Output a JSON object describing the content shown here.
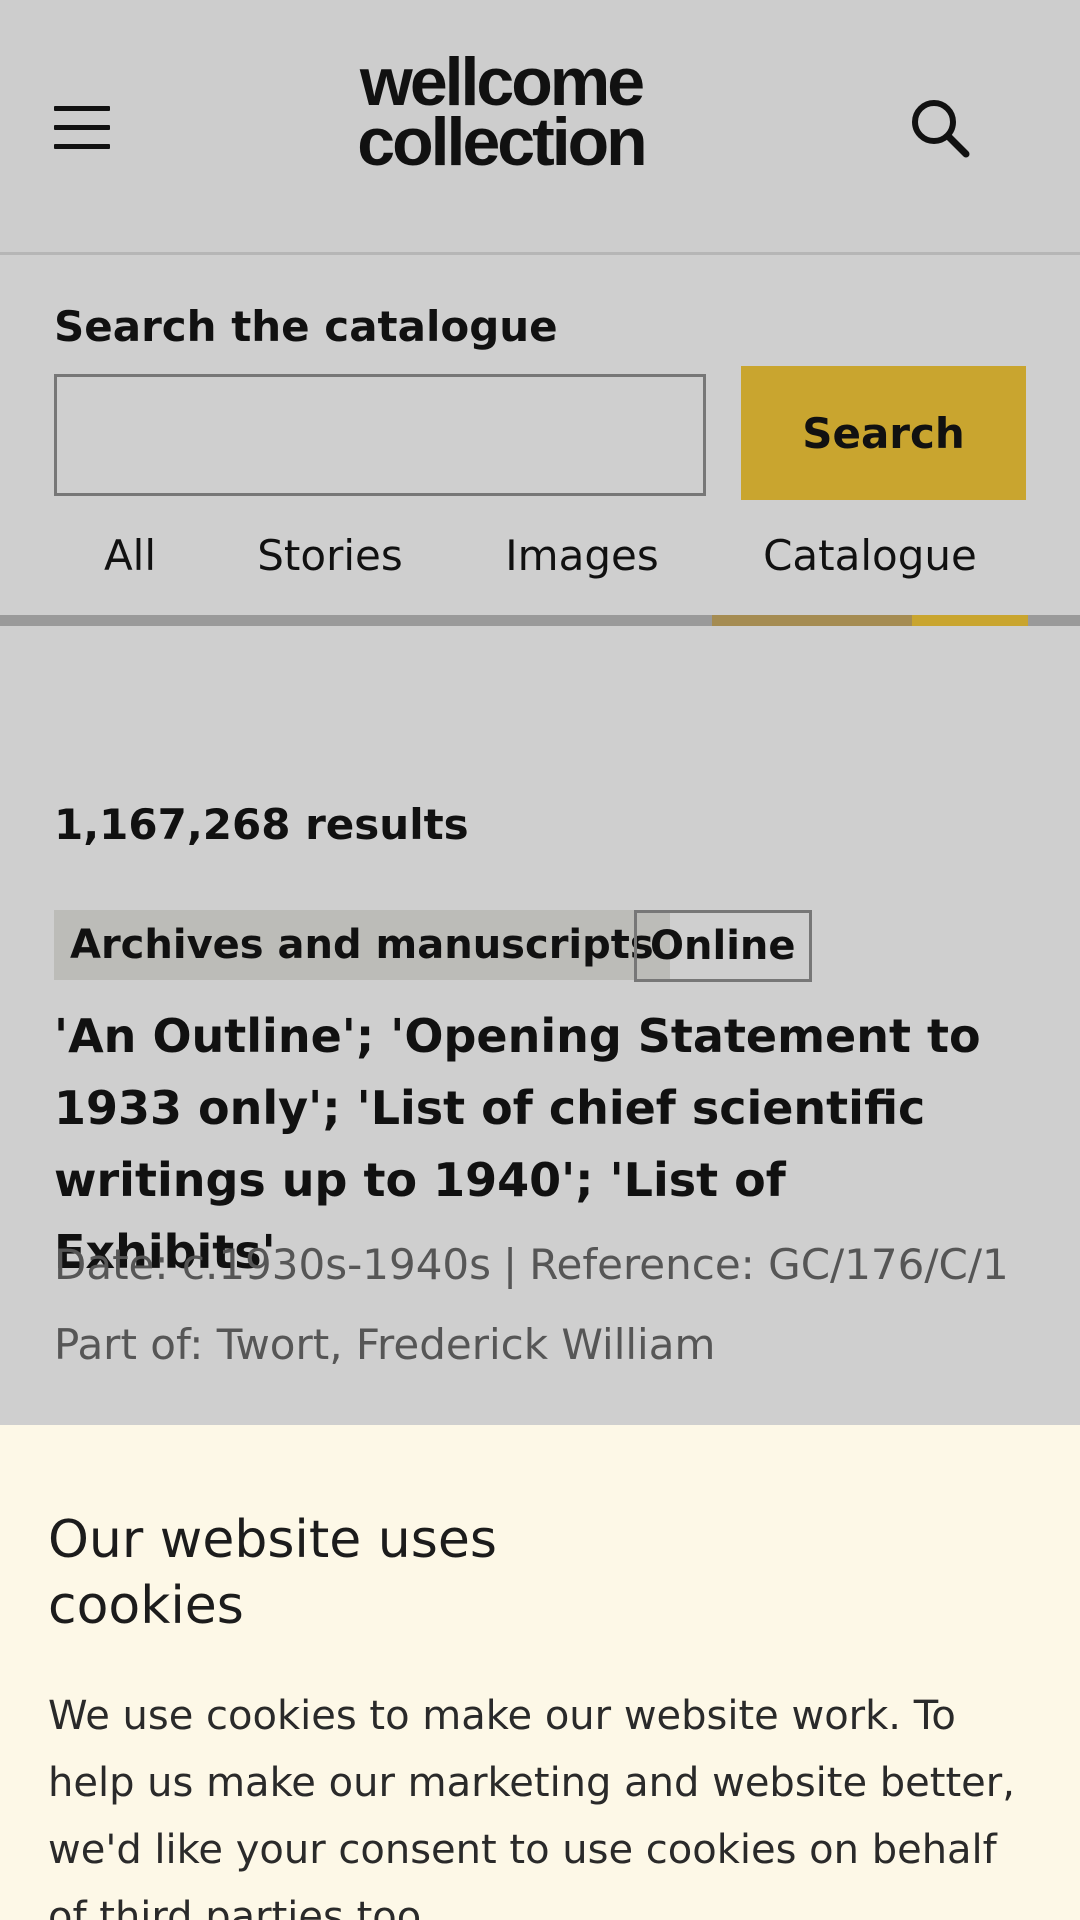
{
  "header": {
    "logo_line1": "wellcome",
    "logo_line2": "collection",
    "menu_icon": "hamburger-menu-icon",
    "search_icon": "search-icon"
  },
  "search": {
    "label": "Search the catalogue",
    "value": "",
    "placeholder": "",
    "button_label": "Search"
  },
  "tabs": [
    {
      "label": "All",
      "active": false
    },
    {
      "label": "Stories",
      "active": false
    },
    {
      "label": "Images",
      "active": false
    },
    {
      "label": "Catalogue",
      "active": true
    }
  ],
  "results": {
    "count_label": "1,167,268 results",
    "items": [
      {
        "format": "Archives and manuscripts",
        "availability": "Online",
        "title": "'An Outline'; 'Opening Statement to 1933 only'; 'List of chief scientific writings up to 1940'; 'List of Exhibits'",
        "date": "Date: c.1930s-1940s",
        "separator": "|",
        "reference": "Reference: GC/176/C/1",
        "part_of": "Part of: Twort, Frederick William"
      }
    ]
  },
  "cookie_banner": {
    "title": "Our website uses cookies",
    "body": "We use cookies to make our website work. To help us make our marketing and website better, we'd like your consent to use cookies on behalf of third parties too."
  },
  "colors": {
    "accent": "#c9a52f",
    "background": "#cfcfcf",
    "cookie_background": "#fdf8e7"
  }
}
